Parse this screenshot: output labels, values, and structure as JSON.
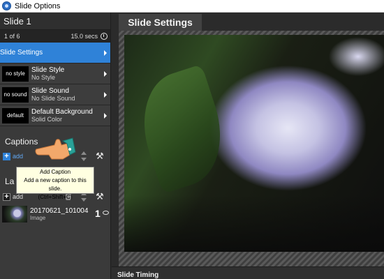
{
  "window": {
    "title": "Slide Options"
  },
  "slide": {
    "title": "Slide 1",
    "position": "1 of 6",
    "duration": "15.0 secs"
  },
  "menu": [
    {
      "thumb": "",
      "label": "Slide Settings",
      "sub": "",
      "active": true
    },
    {
      "thumb": "no style",
      "label": "Slide Style",
      "sub": "No Style"
    },
    {
      "thumb": "no sound",
      "label": "Slide Sound",
      "sub": "No Slide Sound"
    },
    {
      "thumb": "default",
      "label": "Default Background",
      "sub": "Solid Color"
    }
  ],
  "captions": {
    "title": "Captions",
    "add_label": "add"
  },
  "tooltip": {
    "title": "Add Caption",
    "line1": "Add a new caption to this slide.",
    "line2": "(Ctrl+Shift+C)"
  },
  "layers": {
    "title": "La",
    "add_label": "add",
    "items": [
      {
        "name": "20170621_101004",
        "type": "Image",
        "number": "1"
      }
    ]
  },
  "main": {
    "tab": "Slide Settings",
    "bottom_label": "Slide Timing"
  },
  "colors": {
    "accent": "#2f82d8",
    "background": "#2b2b2b",
    "panel": "#3a3a3a"
  }
}
